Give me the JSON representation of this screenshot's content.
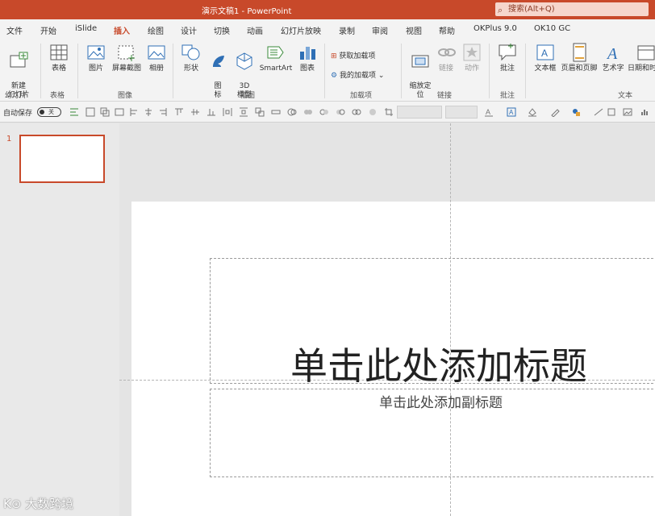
{
  "window": {
    "title": "演示文稿1  -  PowerPoint",
    "search_placeholder": "搜索(Alt+Q)"
  },
  "tabs": [
    "文件",
    "开始",
    "iSlide",
    "插入",
    "绘图",
    "设计",
    "切换",
    "动画",
    "幻灯片放映",
    "录制",
    "审阅",
    "视图",
    "帮助",
    "OKPlus 9.0",
    "OK10 GC"
  ],
  "active_tab": "插入",
  "ribbon": {
    "new_slide": "新建\n幻灯片",
    "table": "表格",
    "picture": "图片",
    "screenshot": "屏幕截图",
    "album": "相册",
    "shapes": "形状",
    "icons": "图\n标",
    "model3d": "3D\n模型",
    "smartart": "SmartArt",
    "chart": "图表",
    "get_addins": "获取加载项",
    "my_addins": "我的加载项",
    "zoom": "缩放定\n位",
    "link": "链接",
    "action": "动作",
    "comment": "批注",
    "textbox": "文本框",
    "header_footer": "页眉和页脚",
    "wordart": "艺术字",
    "datetime": "日期和时",
    "groups": {
      "slides": "幻灯片",
      "tables": "表格",
      "images": "图像",
      "illustrations": "插图",
      "addins": "加载项",
      "links": "链接",
      "comments": "批注",
      "text": "文本"
    }
  },
  "quickbar": {
    "autosave_label": "自动保存",
    "autosave_state": "关"
  },
  "thumbnails": [
    {
      "number": "1"
    }
  ],
  "slide": {
    "title_placeholder": "单击此处添加标题",
    "subtitle_placeholder": "单击此处添加副标题"
  },
  "watermark": "K⊙ 大数跨境",
  "colors": {
    "accent": "#c8492a",
    "ribbon_bg": "#f3f3f3"
  }
}
